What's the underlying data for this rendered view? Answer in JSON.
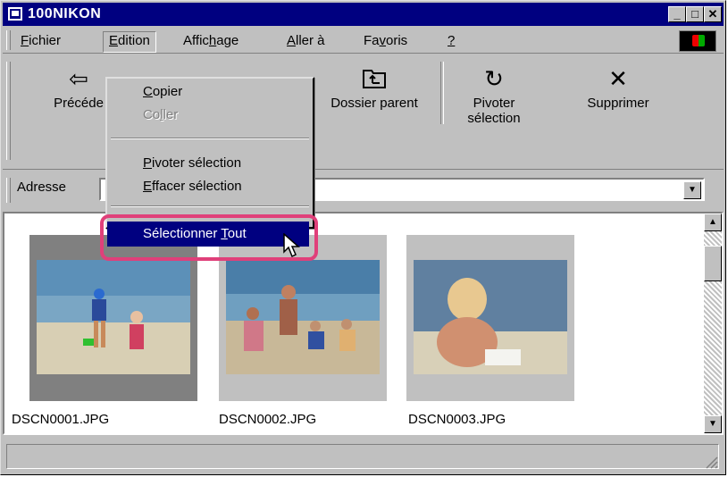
{
  "window": {
    "title": "100NIKON"
  },
  "menubar": {
    "items": [
      {
        "label": "Fichier",
        "key": "F"
      },
      {
        "label": "Edition",
        "key": "E"
      },
      {
        "label": "Affichage",
        "key": "h"
      },
      {
        "label": "Aller à",
        "key": "A"
      },
      {
        "label": "Favoris",
        "key": "v"
      },
      {
        "label": "?",
        "key": "?"
      }
    ]
  },
  "toolbar": {
    "back_label": "Précédente",
    "back_visible": "Précéde",
    "parent_label": "Dossier parent",
    "rotate_label_1": "Pivoter",
    "rotate_label_2": "sélection",
    "delete_label": "Supprimer"
  },
  "address": {
    "label": "Adresse"
  },
  "edit_menu": {
    "items": [
      {
        "label": "Copier",
        "enabled": true
      },
      {
        "label": "Coller",
        "enabled": false
      },
      {
        "label": "Pivoter sélection",
        "enabled": true
      },
      {
        "label": "Effacer sélection",
        "enabled": true
      },
      {
        "label": "Sélectionner Tout",
        "enabled": true,
        "highlighted": true
      }
    ]
  },
  "files": [
    {
      "name": "DSCN0001.JPG",
      "selected": true
    },
    {
      "name": "DSCN0002.JPG",
      "selected": false
    },
    {
      "name": "DSCN0003.JPG",
      "selected": false
    }
  ],
  "colors": {
    "titlebar": "#000080",
    "highlight_ring": "#e0407a",
    "chrome": "#c0c0c0"
  }
}
